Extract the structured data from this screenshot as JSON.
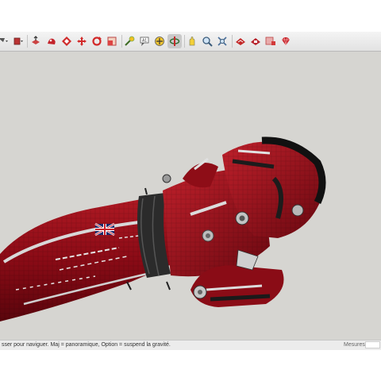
{
  "toolbar": {
    "tools": [
      {
        "name": "select-dropdown-icon"
      },
      {
        "name": "paint-dropdown-icon"
      },
      {
        "name": "push-pull-icon"
      },
      {
        "name": "follow-me-icon"
      },
      {
        "name": "offset-icon"
      },
      {
        "name": "move-icon"
      },
      {
        "name": "rotate-icon"
      },
      {
        "name": "scale-icon"
      },
      {
        "name": "tape-measure-icon"
      },
      {
        "name": "text-icon"
      },
      {
        "name": "axes-icon"
      },
      {
        "name": "orbit-icon"
      },
      {
        "name": "pan-icon"
      },
      {
        "name": "zoom-icon"
      },
      {
        "name": "zoom-extents-icon"
      },
      {
        "name": "warehouse-icon"
      },
      {
        "name": "extension-warehouse-icon"
      },
      {
        "name": "layout-icon"
      },
      {
        "name": "ruby-icon"
      }
    ],
    "active_tool": "orbit-icon"
  },
  "status": {
    "message": "sser pour naviguer. Maj = panoramique, Option =  suspend la gravité."
  },
  "measurements": {
    "label": "Mesures",
    "value": ""
  },
  "colors": {
    "hull_red": "#8c0b16",
    "viewport_bg": "#d6d5d1"
  }
}
